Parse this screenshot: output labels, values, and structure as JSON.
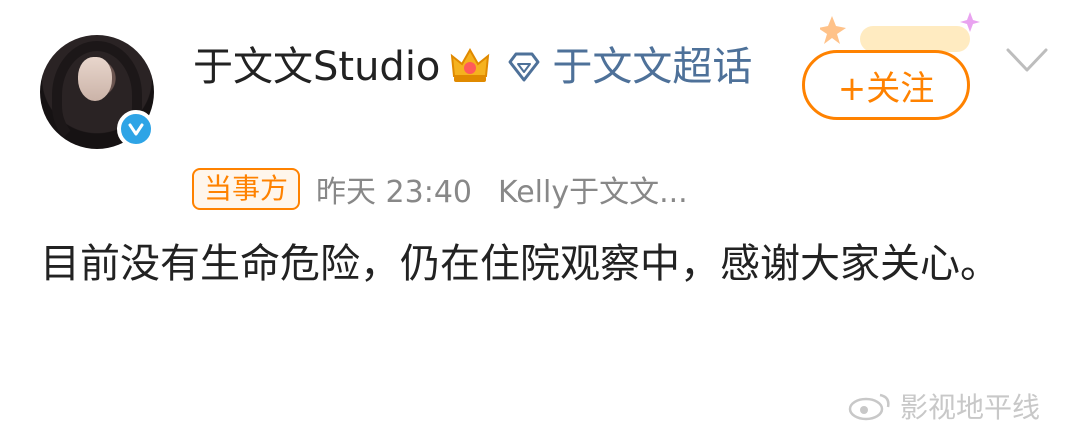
{
  "post": {
    "author": {
      "username": "于文文Studio",
      "verified": true,
      "badges": [
        "crown-icon",
        "diamond-icon"
      ]
    },
    "topic_link": "于文文超话",
    "follow_button": "+关注",
    "party_badge": "当事方",
    "time": "昨天 23:40",
    "source": "Kelly于文文...",
    "content": "目前没有生命危险，仍在住院观察中，感谢大家关心。"
  },
  "watermark": {
    "text": "影视地平线"
  },
  "colors": {
    "accent": "#ff8200",
    "link": "#4e7199",
    "verified": "#2ea4e6",
    "meta_text": "#888888"
  }
}
